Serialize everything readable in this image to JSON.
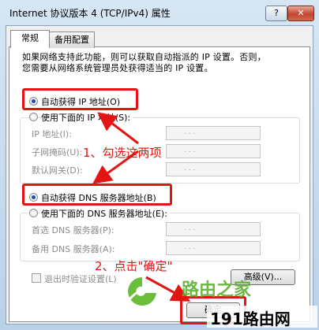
{
  "window": {
    "title": "Internet 协议版本 4 (TCP/IPv4) 属性",
    "help_label": "?",
    "close_label": "✕"
  },
  "tabs": [
    {
      "label": "常规",
      "active": true
    },
    {
      "label": "备用配置",
      "active": false
    }
  ],
  "description": "如果网络支持此功能，则可以获取自动指派的 IP 设置。否则，\n您需要从网络系统管理员处获得适当的 IP 设置。",
  "ip_section": {
    "auto_label": "自动获得 IP 地址(O)",
    "manual_label": "使用下面的 IP 地址(S):",
    "selected": "auto",
    "fields": [
      {
        "label": "IP 地址(I):",
        "value": ". . ."
      },
      {
        "label": "子网掩码(U):",
        "value": ". . ."
      },
      {
        "label": "默认网关(D):",
        "value": ". . ."
      }
    ]
  },
  "dns_section": {
    "auto_label": "自动获得 DNS 服务器地址(B)",
    "manual_label": "使用下面的 DNS 服务器地址(E):",
    "selected": "auto",
    "fields": [
      {
        "label": "首选 DNS 服务器(P):",
        "value": ". . ."
      },
      {
        "label": "备用 DNS 服务器(A):",
        "value": ". . ."
      }
    ]
  },
  "validate_checkbox": {
    "label": "退出时验证设置(L)",
    "checked": false
  },
  "advanced_button": "高级(V)...",
  "ok_button": "确定",
  "annotations": {
    "step1": "1、勾选这两项",
    "step2": "2、点击\"确定\"",
    "highlight_color": "#e31414"
  },
  "watermarks": {
    "center": "路由之家",
    "corner": "191路由网"
  }
}
